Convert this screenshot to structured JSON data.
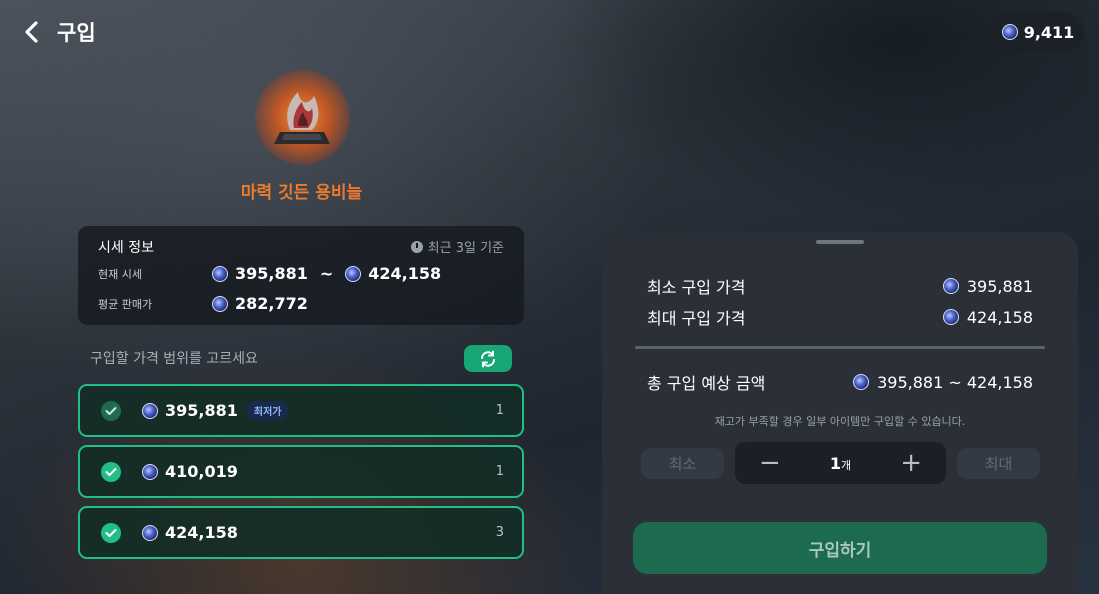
{
  "header": {
    "title": "구입"
  },
  "currency": {
    "amount": "9,411",
    "icon": "blue-coin-icon"
  },
  "item": {
    "name": "마력 깃든 용비늘",
    "icon": "dragon-scale-icon"
  },
  "price_info": {
    "title": "시세 정보",
    "period": "최근 3일 기준",
    "current_label": "현재 시세",
    "current_min": "395,881",
    "tilde": "~",
    "current_max": "424,158",
    "average_label": "평균 판매가",
    "average": "282,772"
  },
  "range": {
    "label": "구입할 가격 범위를 고르세요",
    "rows": [
      {
        "price": "395,881",
        "tag": "최저가",
        "qty": "1",
        "checked": true
      },
      {
        "price": "410,019",
        "qty": "1",
        "checked": true
      },
      {
        "price": "424,158",
        "qty": "3",
        "checked": true
      }
    ]
  },
  "panel": {
    "min_price_label": "최소 구입 가격",
    "min_price": "395,881",
    "max_price_label": "최대 구입 가격",
    "max_price": "424,158",
    "total_label": "총 구입 예상 금액",
    "total": "395,881 ~ 424,158",
    "note": "재고가 부족할 경우 일부 아이템만 구입할 수 있습니다.",
    "min_button": "최소",
    "max_button": "최대",
    "quantity": "1",
    "unit": "개",
    "minus": "−",
    "plus": "+",
    "buy_button": "구입하기"
  },
  "colors": {
    "accent": "#1fbf85",
    "item_name": "#ef7a2f",
    "buy_button": "#1d6b4f"
  }
}
